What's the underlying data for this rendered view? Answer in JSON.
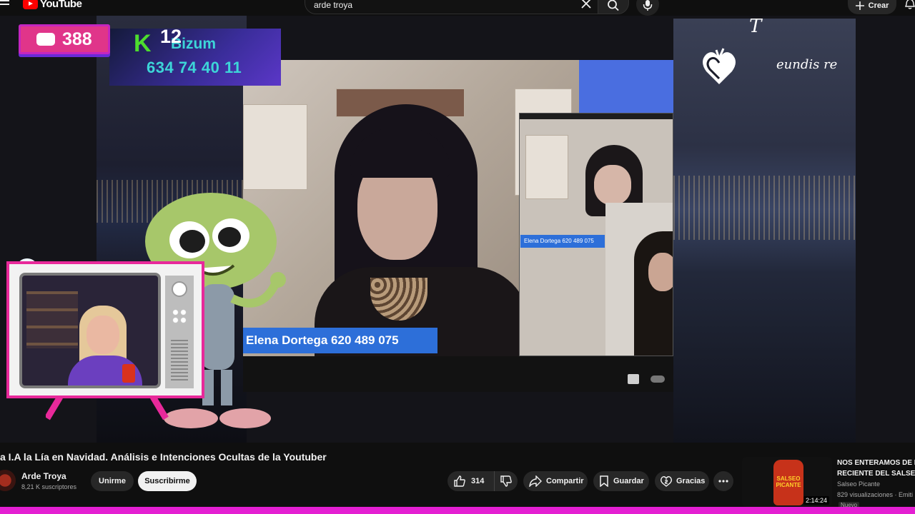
{
  "header": {
    "logo_text": "YouTube",
    "search_value": "arde troya",
    "create_label": "Crear"
  },
  "overlay": {
    "like_count": "388",
    "counter_number": "12",
    "bizum_word": "Bizum",
    "bizum_phone": "634 74 40 11",
    "main_name_tag": "Elena Dortega 620 489 075",
    "inset_name_tag": "Elena Dortega 620 489 075",
    "deco_text": "eundis re",
    "deco_letter": "T"
  },
  "video": {
    "title": "a I.A la Lía en Navidad. Análisis e Intenciones Ocultas de la Youtuber"
  },
  "channel": {
    "name": "Arde Troya",
    "subscribers": "8,21 K suscriptores",
    "join_label": "Unirme",
    "subscribe_label": "Suscribirme"
  },
  "actions": {
    "likes": "314",
    "share_label": "Compartir",
    "save_label": "Guardar",
    "thanks_label": "Gracias"
  },
  "recommended": {
    "title_line1": "NOS ENTERAMOS DE L",
    "title_line2": "RECIENTE DEL SALSEO",
    "channel": "Salseo Picante",
    "views": "829 visualizaciones · Emiti",
    "badge": "Nuevo",
    "duration": "2:14:24",
    "thumb_label": "SALSEO PICANTE"
  },
  "colors": {
    "accent_pink": "#e0358a",
    "name_tag_blue": "#2d6fd9",
    "bizum_cyan": "#3dd5d8",
    "bizum_green": "#4ddd2e",
    "taskbar_magenta": "#e41fd2"
  }
}
